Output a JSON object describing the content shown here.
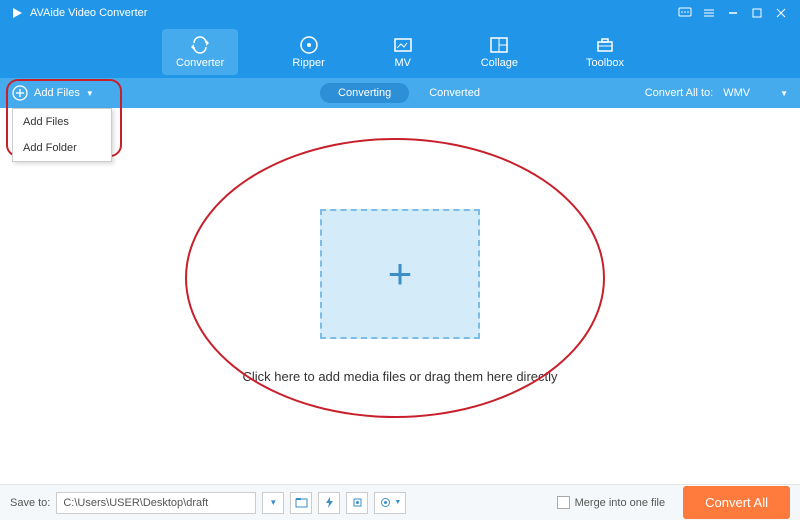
{
  "app": {
    "title": "AVAide Video Converter"
  },
  "nav": {
    "items": [
      {
        "label": "Converter"
      },
      {
        "label": "Ripper"
      },
      {
        "label": "MV"
      },
      {
        "label": "Collage"
      },
      {
        "label": "Toolbox"
      }
    ]
  },
  "subbar": {
    "add_files": "Add Files",
    "tab_converting": "Converting",
    "tab_converted": "Converted",
    "convert_all_to": "Convert All to:",
    "format": "WMV"
  },
  "dropdown": {
    "add_files": "Add Files",
    "add_folder": "Add Folder"
  },
  "main": {
    "drop_text": "Click here to add media files or drag them here directly"
  },
  "bottom": {
    "save_to_label": "Save to:",
    "save_to_path": "C:\\Users\\USER\\Desktop\\draft",
    "merge_label": "Merge into one file",
    "convert_all": "Convert All"
  }
}
